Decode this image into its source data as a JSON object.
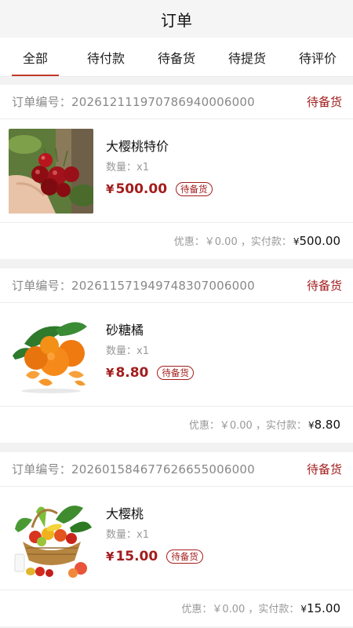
{
  "header": {
    "title": "订单"
  },
  "tabs": [
    {
      "label": "全部",
      "active": true
    },
    {
      "label": "待付款",
      "active": false
    },
    {
      "label": "待备货",
      "active": false
    },
    {
      "label": "待提货",
      "active": false
    },
    {
      "label": "待评价",
      "active": false
    }
  ],
  "orders": [
    {
      "order_no": "订单编号：20261211197078694000600​0",
      "status": "待备货",
      "image_icon": "cherries-photo",
      "product_name": "大樱桃特价",
      "quantity": "数量：x1",
      "currency": "¥",
      "price": "500.00",
      "badge": "待备货",
      "discount": "优惠：￥0.00 ，实付款：",
      "paid_currency": "¥",
      "paid": "500.00"
    },
    {
      "order_no": "订单编号：20261157194974830700600​0",
      "status": "待备货",
      "image_icon": "mandarin-oranges-photo",
      "product_name": "砂糖橘",
      "quantity": "数量：x1",
      "currency": "¥",
      "price": "8.80",
      "badge": "待备货",
      "discount": "优惠：￥0.00 ，实付款：",
      "paid_currency": "¥",
      "paid": "8.80"
    },
    {
      "order_no": "订单编号：20260158467762665500600​0",
      "status": "待备货",
      "image_icon": "fruit-basket-photo",
      "product_name": "大樱桃",
      "quantity": "数量：x1",
      "currency": "¥",
      "price": "15.00",
      "badge": "待备货",
      "discount": "优惠：￥0.00 ，实付款：",
      "paid_currency": "¥",
      "paid": "15.00"
    }
  ],
  "colors": {
    "accent": "#a31d1d",
    "muted": "#999999",
    "background": "#f2f2f2"
  }
}
